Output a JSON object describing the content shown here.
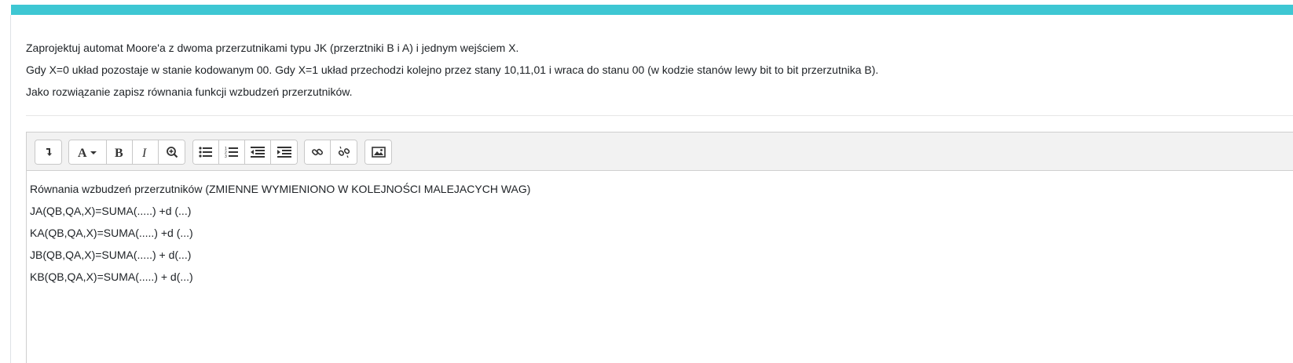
{
  "question": {
    "lines": [
      "Zaprojektuj automat Moore'a z dwoma przerzutnikami typu JK (przerztniki B i A) i jednym wejściem X.",
      "Gdy X=0 układ pozostaje w stanie kodowanym 00. Gdy X=1 układ przechodzi kolejno przez stany 10,11,01 i wraca do stanu 00 (w kodzie stanów lewy bit to bit przerzutnika B).",
      "Jako rozwiązanie zapisz równania funkcji wzbudzeń przerzutników."
    ]
  },
  "toolbar": {
    "buttons": [
      {
        "icon": "collapse-toolbar-icon"
      },
      {
        "icon": "font-style-icon",
        "label": "A"
      },
      {
        "icon": "bold-icon",
        "label": "B"
      },
      {
        "icon": "italic-icon",
        "label": "I"
      },
      {
        "icon": "accessibility-checker-icon"
      },
      {
        "icon": "unordered-list-icon"
      },
      {
        "icon": "ordered-list-icon"
      },
      {
        "icon": "outdent-icon"
      },
      {
        "icon": "indent-icon"
      },
      {
        "icon": "link-icon"
      },
      {
        "icon": "unlink-icon"
      },
      {
        "icon": "image-icon"
      }
    ]
  },
  "editor": {
    "lines": [
      "Równania wzbudzeń przerzutników (ZMIENNE WYMIENIONO W KOLEJNOŚCI MALEJACYCH WAG)",
      "JA(QB,QA,X)=SUMA(.....) +d (...)",
      "KA(QB,QA,X)=SUMA(.....) +d (...)",
      "JB(QB,QA,X)=SUMA(.....) + d(...)",
      "KB(QB,QA,X)=SUMA(.....) + d(...)"
    ]
  },
  "colors": {
    "accent_bar": "#3ec7d3",
    "toolbar_bg": "#f2f2f2",
    "text": "#1d2125"
  }
}
